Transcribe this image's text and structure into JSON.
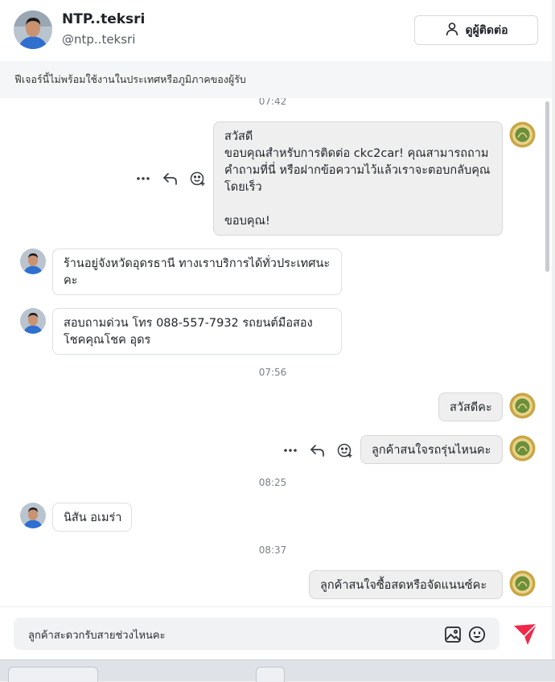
{
  "contact": {
    "name": "NTP..teksri",
    "handle": "@ntp..teksri",
    "view_contact_label": "ดูผู้ติดต่อ"
  },
  "banner": "ฟีเจอร์นี้ไม่พร้อมใช้งานในประเทศหรือภูมิภาคของผู้รับ",
  "timestamps": [
    "07:42",
    "07:56",
    "08:25",
    "08:37"
  ],
  "messages": [
    {
      "from": "page",
      "text": "สวัสดี\nขอบคุณสำหรับการติดต่อ ckc2car! คุณสามารถถามคำถามที่นี่ หรือฝากข้อความไว้แล้วเราจะตอบกลับคุณโดยเร็ว\n\nขอบคุณ!"
    },
    {
      "from": "user",
      "text": "ร้านอยู่จังหวัดอุดรธานี ทางเราบริการได้ทั่วประเทศนะคะ"
    },
    {
      "from": "user",
      "text": "สอบถามด่วน โทร 088-557-7932 รถยนต์มือสองโชคคุณโชค อุดร"
    },
    {
      "from": "page",
      "text": "สวัสดีคะ"
    },
    {
      "from": "page",
      "text": "ลูกค้าสนใจรถรุ่นไหนคะ"
    },
    {
      "from": "user",
      "text": "นิสัน อเมร่า"
    },
    {
      "from": "page",
      "text": "ลูกค้าสนใจซื้อสดหรือจัดแนนซ์คะ"
    }
  ],
  "composer": {
    "value": "ลูกค้าสะดวกรับสายช่วงไหนคะ",
    "image_icon": "image-icon",
    "emoji_icon": "emoji-icon",
    "send_icon": "send-icon"
  },
  "colors": {
    "accent": "#f0284a",
    "outgoing_bubble": "#efefef",
    "incoming_bubble": "#ffffff"
  }
}
